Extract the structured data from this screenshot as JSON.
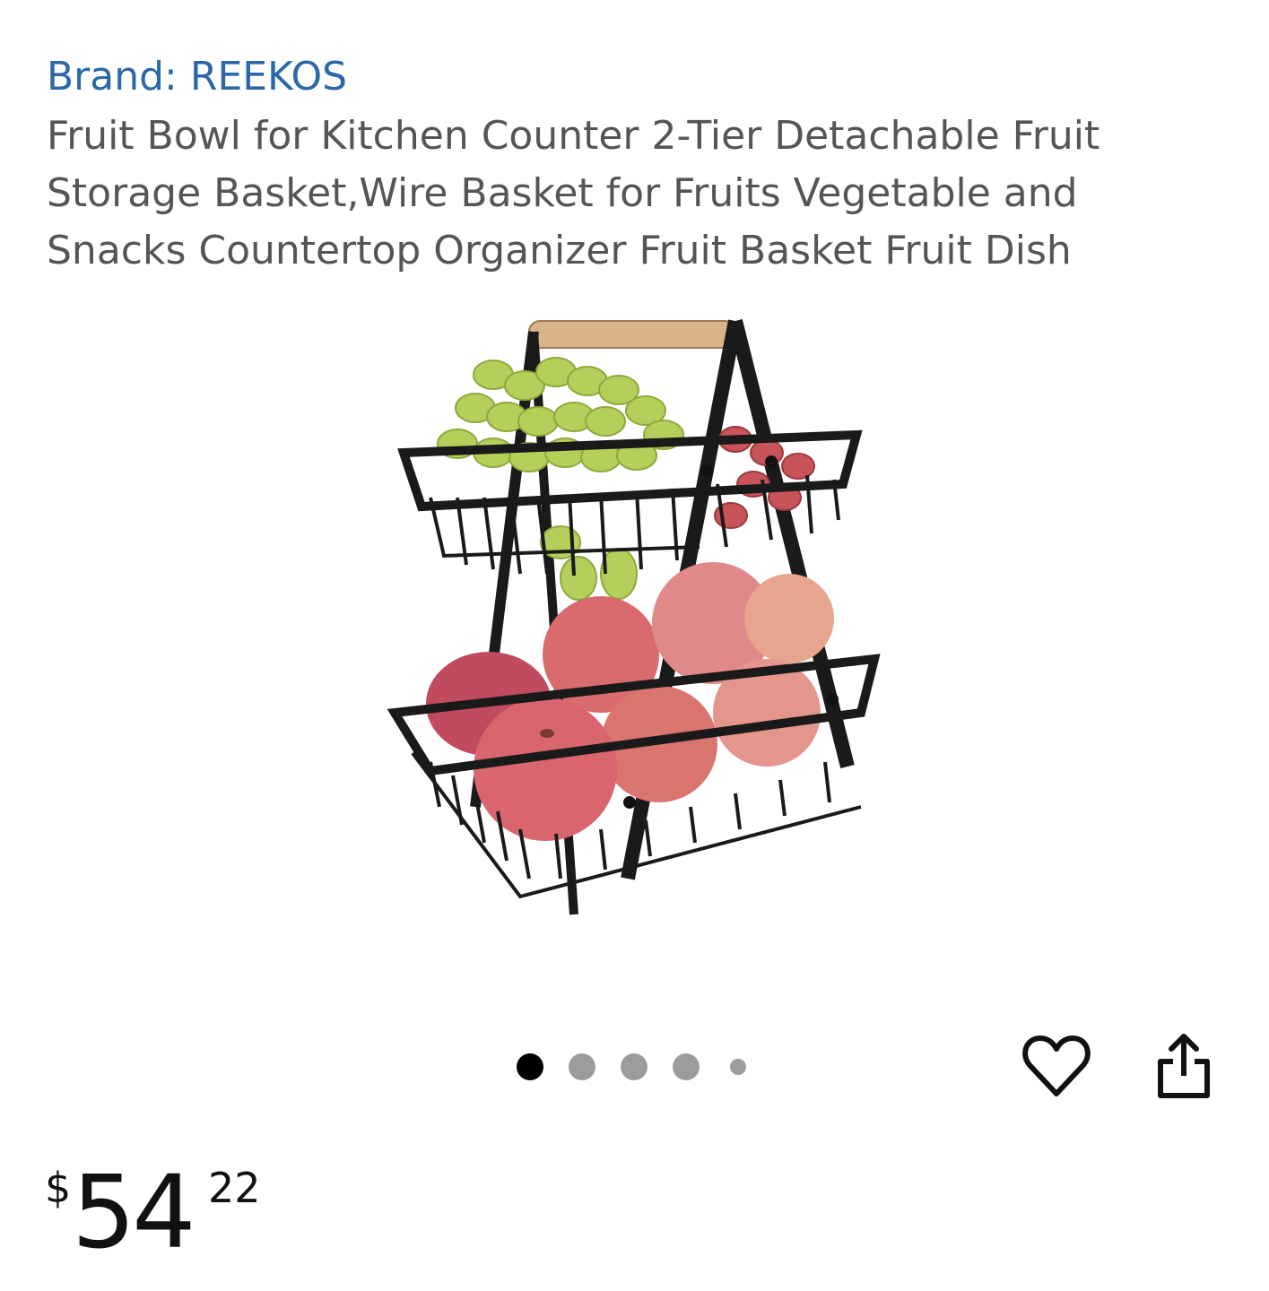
{
  "product": {
    "brand": "Brand: REEKOS",
    "title": "Fruit Bowl for Kitchen Counter 2-Tier Detachable Fruit Storage Basket,Wire Basket for Fruits Vegetable and Snacks Countertop Organizer Fruit Basket Fruit Dish",
    "image_alt": "2-tier black wire fruit basket with grapes and apples"
  },
  "gallery": {
    "image_count": 5,
    "active_index": 0
  },
  "actions": {
    "favorite_icon": "heart-icon",
    "share_icon": "share-icon"
  },
  "price": {
    "currency": "$",
    "whole": "54",
    "fraction": "22"
  },
  "colors": {
    "brand_link": "#2a68a8",
    "title_text": "#555555",
    "dot_active": "#000000",
    "dot_inactive": "#9c9c9c"
  }
}
